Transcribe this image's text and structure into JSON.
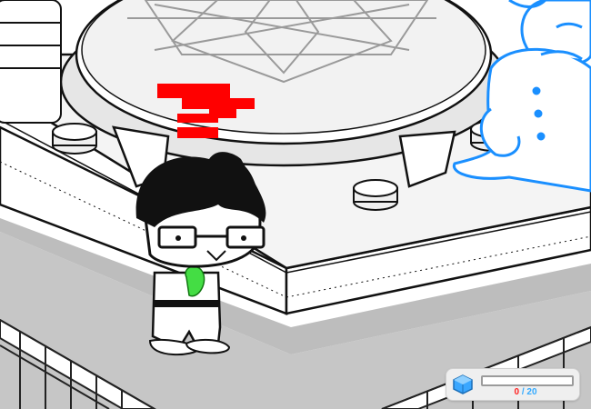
{
  "hud": {
    "grist": {
      "current": "0",
      "separator": " / ",
      "max": "20",
      "level_fraction": 0.0,
      "icon": "blue-grist-cube-icon"
    }
  },
  "colors": {
    "grist_current": "#ff2020",
    "grist_max": "#33aaff",
    "glow_outline": "#1a8fff",
    "speech_bubble": "#ff0000",
    "shirt_emblem": "#44dd44",
    "floor": "#c6c6c6"
  }
}
